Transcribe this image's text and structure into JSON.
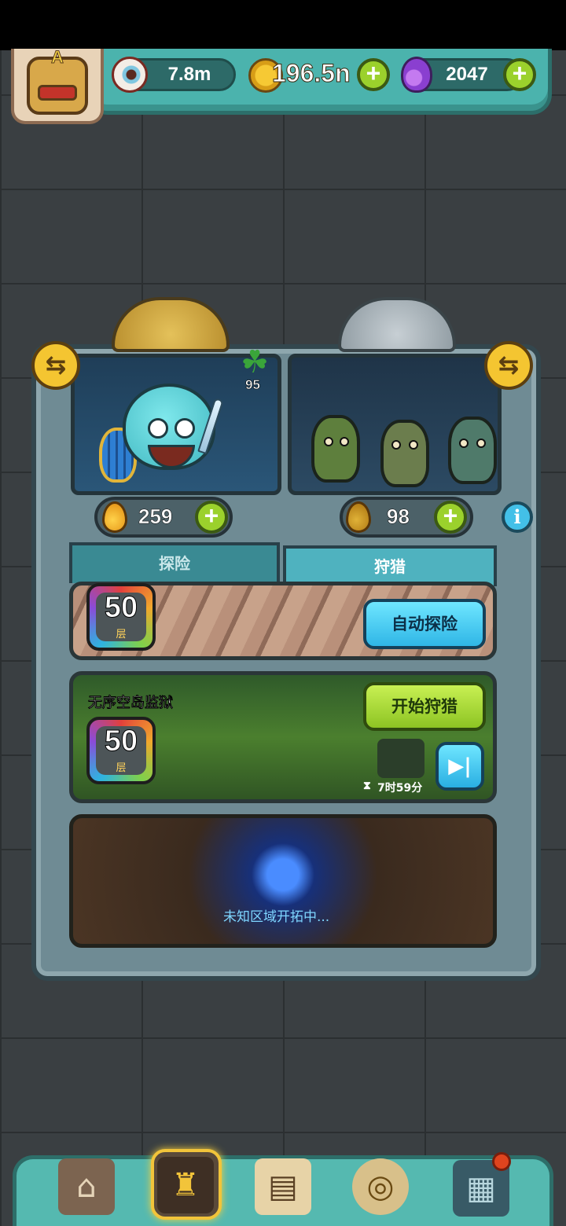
{
  "hud": {
    "avatar_letter": "A",
    "eye_value": "7.8m",
    "coins_value": "196.5n",
    "potion_value": "2047"
  },
  "stage": {
    "clover_count": "95",
    "left_resource": "259",
    "right_resource": "98"
  },
  "tabs": [
    {
      "label": "探险",
      "active": false
    },
    {
      "label": "狩猎",
      "active": true
    }
  ],
  "explore_panel": {
    "floor_number": "50",
    "floor_unit": "层",
    "button_label": "自动探险"
  },
  "hunt_panel": {
    "zone_name": "无序空岛监狱",
    "floor_number": "50",
    "floor_unit": "层",
    "button_label": "开始狩猎",
    "timer": "7时59分"
  },
  "unknown_panel": {
    "status_text": "未知区域开拓中..."
  },
  "bottom_nav": [
    {
      "icon": "shop-icon",
      "selected": false
    },
    {
      "icon": "hero-den-icon",
      "selected": true
    },
    {
      "icon": "book-icon",
      "selected": false
    },
    {
      "icon": "money-bag-icon",
      "selected": false
    },
    {
      "icon": "menu-grid-icon",
      "selected": false,
      "has_notification": true
    }
  ],
  "colors": {
    "hud_teal": "#4bb3ad",
    "plus_green": "#9bd12c",
    "button_blue": "#2fb6e6",
    "button_green": "#8dc423",
    "accent_gold": "#f4c531"
  }
}
